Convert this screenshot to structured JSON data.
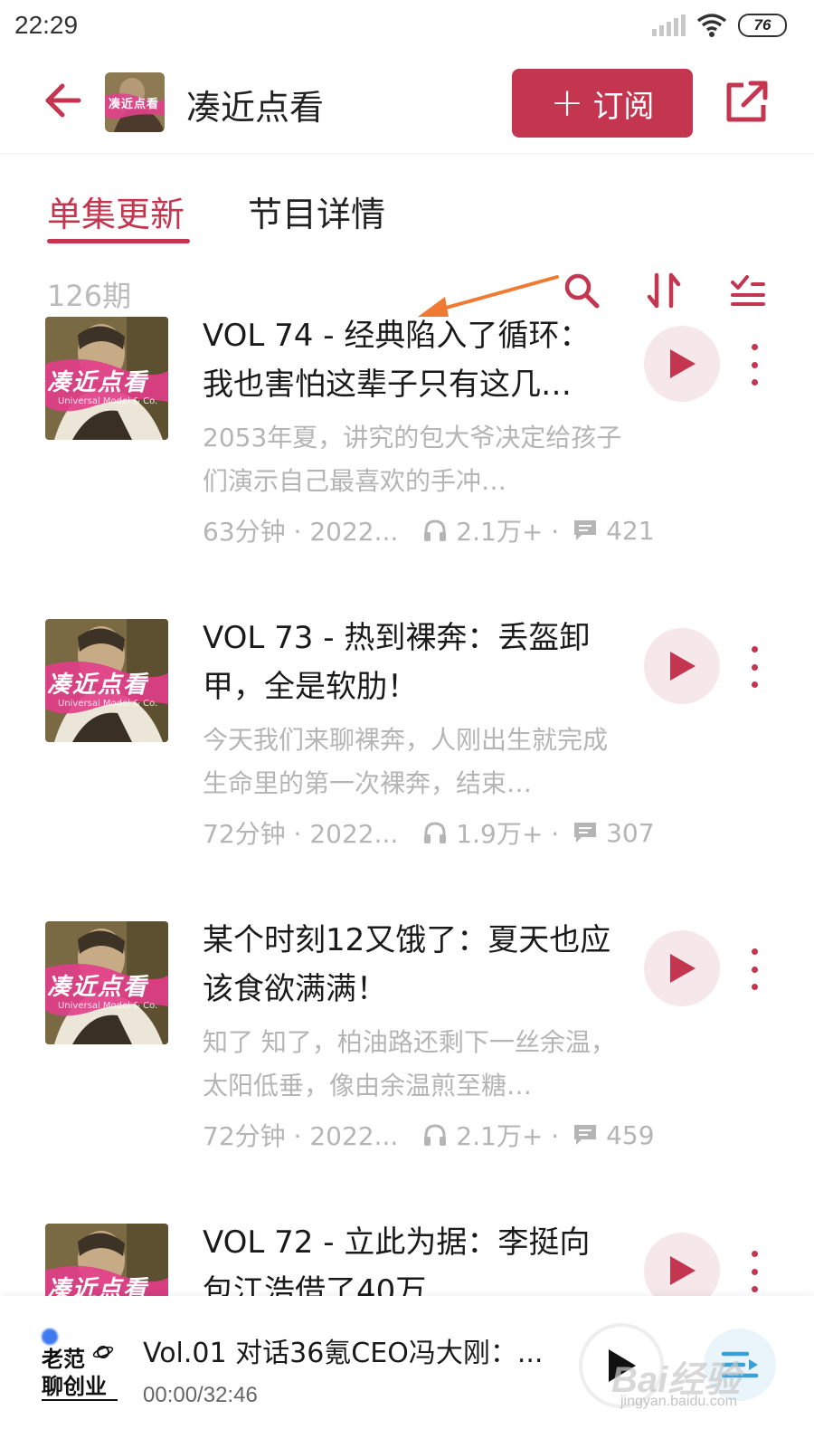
{
  "status_bar": {
    "time": "22:29",
    "battery": "76"
  },
  "header": {
    "title": "凑近点看",
    "subscribe_label": "订阅",
    "subscribe_plus": "+",
    "cover_text": "凑近点看",
    "icons": {
      "back": "back-arrow-icon",
      "share": "share-icon"
    }
  },
  "tabs": [
    {
      "label": "单集更新",
      "active": true
    },
    {
      "label": "节目详情",
      "active": false
    }
  ],
  "list": {
    "count": "126期",
    "cover_text": "凑近点看",
    "cover_sub": "Universal Model & Co."
  },
  "episodes": [
    {
      "title": "VOL 74 - 经典陷入了循环：我也害怕这辈子只有这几…",
      "desc": "2053年夏，讲究的包大爷决定给孩子们演示自己最喜欢的手冲…",
      "duration_date": "63分钟 · 2022...",
      "plays": "2.1万+ ·",
      "comments": "421"
    },
    {
      "title": "VOL 73 - 热到裸奔：丢盔卸甲，全是软肋！",
      "desc": "今天我们来聊裸奔，人刚出生就完成生命里的第一次裸奔，结束…",
      "duration_date": "72分钟 · 2022...",
      "plays": "1.9万+ ·",
      "comments": "307"
    },
    {
      "title": "某个时刻12又饿了：夏天也应该食欲满满！",
      "desc": "知了 知了，柏油路还剩下一丝余温，太阳低垂，像由余温煎至糖…",
      "duration_date": "72分钟 · 2022...",
      "plays": "2.1万+ ·",
      "comments": "459"
    },
    {
      "title": "VOL 72 - 立此为据：李挺向包江浩借了40万",
      "desc": "",
      "duration_date": "",
      "plays": "",
      "comments": ""
    }
  ],
  "player": {
    "logo_line1": "老范",
    "logo_line2": "聊创业",
    "title": "Vol.01 对话36氪CEO冯大刚：...",
    "time": "00:00/32:46"
  },
  "watermark": {
    "text": "Bai经验",
    "sub": "jingyan.baidu.com"
  },
  "colors": {
    "accent": "#c4354f",
    "play_bg": "#f6e8ea",
    "muted": "#b5b5b5",
    "annotation": "#f07a32"
  }
}
